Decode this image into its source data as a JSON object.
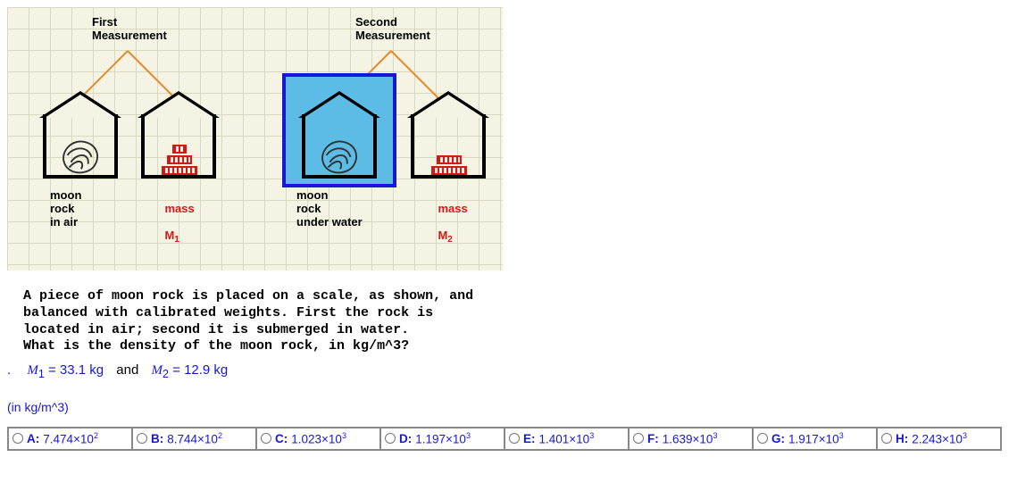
{
  "diagram": {
    "first_measurement_label": "First\nMeasurement",
    "second_measurement_label": "Second\nMeasurement",
    "moon_rock_air_label": "moon\nrock\nin air",
    "mass1_label": "mass",
    "mass1_symbol": "M",
    "mass1_sub": "1",
    "moon_rock_water_label": "moon\nrock\nunder water",
    "mass2_label": "mass",
    "mass2_symbol": "M",
    "mass2_sub": "2"
  },
  "question": "A piece of moon rock is placed on a scale, as shown, and\nbalanced with calibrated weights. First the rock is\nlocated in air; second it is submerged in water.\nWhat is the density of the moon rock, in kg/m^3?",
  "given": {
    "m1_sym": "M",
    "m1_sub": "1",
    "m1_val": "33.1 kg",
    "and": "and",
    "m2_sym": "M",
    "m2_sub": "2",
    "m2_val": "12.9 kg"
  },
  "unit_prompt": "(in kg/m^3)",
  "answers": [
    {
      "letter": "A",
      "mant": "7.474",
      "exp": "2"
    },
    {
      "letter": "B",
      "mant": "8.744",
      "exp": "2"
    },
    {
      "letter": "C",
      "mant": "1.023",
      "exp": "3"
    },
    {
      "letter": "D",
      "mant": "1.197",
      "exp": "3"
    },
    {
      "letter": "E",
      "mant": "1.401",
      "exp": "3"
    },
    {
      "letter": "F",
      "mant": "1.639",
      "exp": "3"
    },
    {
      "letter": "G",
      "mant": "1.917",
      "exp": "3"
    },
    {
      "letter": "H",
      "mant": "2.243",
      "exp": "3"
    }
  ]
}
